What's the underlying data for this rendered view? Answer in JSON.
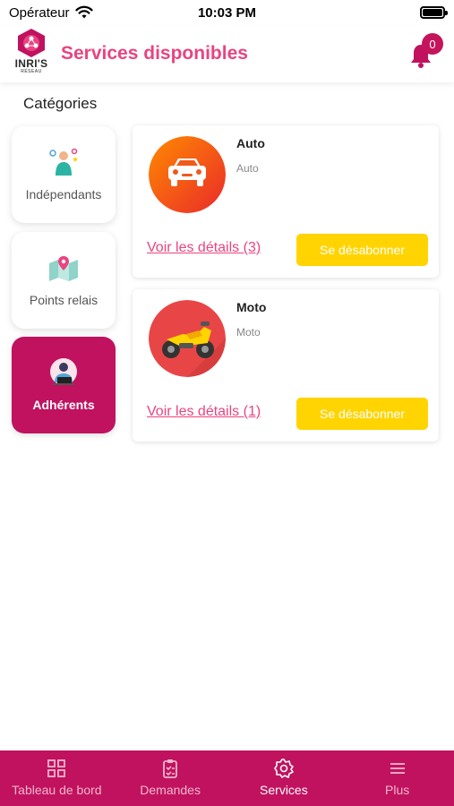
{
  "status_bar": {
    "carrier": "Opérateur",
    "time": "10:03 PM"
  },
  "header": {
    "title": "Services disponibles",
    "logo_text": "INRI'S",
    "logo_subtext": "RÉSEAU",
    "notification_count": "0"
  },
  "categories_title": "Catégories",
  "categories": [
    {
      "label": "Indépendants",
      "icon": "independent-worker-icon",
      "active": false
    },
    {
      "label": "Points relais",
      "icon": "relay-map-icon",
      "active": false
    },
    {
      "label": "Adhérents",
      "icon": "member-laptop-icon",
      "active": true
    }
  ],
  "services": [
    {
      "name": "Auto",
      "subtitle": "Auto",
      "details_link": "Voir les détails (3)",
      "button": "Se désabonner",
      "icon": "car-icon"
    },
    {
      "name": "Moto",
      "subtitle": "Moto",
      "details_link": "Voir les détails (1)",
      "button": "Se désabonner",
      "icon": "motorbike-icon"
    }
  ],
  "tabbar": [
    {
      "label": "Tableau de bord",
      "icon": "dashboard-grid-icon",
      "active": false
    },
    {
      "label": "Demandes",
      "icon": "clipboard-icon",
      "active": false
    },
    {
      "label": "Services",
      "icon": "gear-icon",
      "active": true
    },
    {
      "label": "Plus",
      "icon": "menu-icon",
      "active": false
    }
  ],
  "colors": {
    "brand": "#c0125f",
    "title": "#e94480",
    "button": "#ffd400"
  }
}
